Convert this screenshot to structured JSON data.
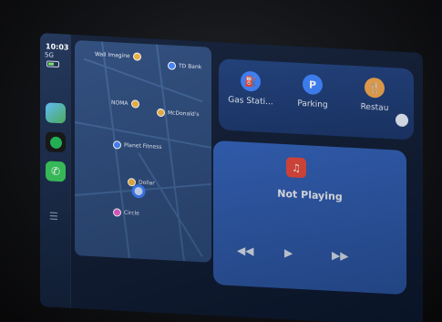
{
  "status": {
    "time": "10:03",
    "signal": "5G"
  },
  "sidebar": {
    "apps": [
      "Maps",
      "Spotify",
      "Phone"
    ]
  },
  "map": {
    "pois": [
      {
        "label": "Wall Imagine",
        "color": "#f2b33d"
      },
      {
        "label": "TD Bank",
        "color": "#3f85ff"
      },
      {
        "label": "NOMA",
        "color": "#f2b33d"
      },
      {
        "label": "McDonald's",
        "color": "#f2b33d"
      },
      {
        "label": "Planet Fitness",
        "color": "#3f85ff"
      },
      {
        "label": "Dollar",
        "color": "#f2b33d"
      },
      {
        "label": "Circle",
        "color": "#ef5bd2"
      }
    ]
  },
  "suggestions": [
    {
      "label": "Gas Stati...",
      "icon": "gas-station-icon",
      "color": "#3a82ff",
      "glyph": "⛽"
    },
    {
      "label": "Parking",
      "icon": "parking-icon",
      "color": "#3a82ff",
      "glyph": "P"
    },
    {
      "label": "Restau",
      "icon": "restaurant-icon",
      "color": "#f0a44a",
      "glyph": "🍴"
    }
  ],
  "now_playing": {
    "status": "Not Playing"
  },
  "controls": {
    "back": "◀◀",
    "play": "▶",
    "forward": "▶▶"
  }
}
